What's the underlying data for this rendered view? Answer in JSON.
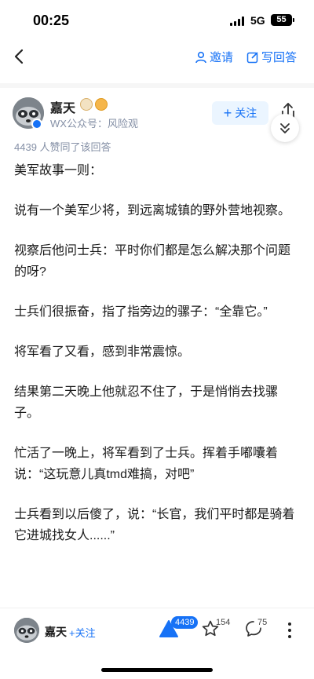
{
  "status_bar": {
    "time": "00:25",
    "network": "5G",
    "battery": "55"
  },
  "nav": {
    "invite_label": "邀请",
    "write_answer_label": "写回答"
  },
  "author": {
    "name": "嘉天",
    "description": "WX公众号：风险观",
    "follow_label": "关注"
  },
  "likes_line": "4439 人赞同了该回答",
  "content": {
    "paragraphs": [
      "美军故事一则：",
      "说有一个美军少将，到远离城镇的野外营地视察。",
      "视察后他问士兵：平时你们都是怎么解决那个问题的呀?",
      "士兵们很振奋，指了指旁边的骡子：“全靠它。”",
      "将军看了又看，感到非常震惊。",
      "结果第二天晚上他就忍不住了，于是悄悄去找骡子。",
      "忙活了一晚上，将军看到了士兵。挥着手嘟囔着说：“这玩意儿真tmd难搞，对吧”",
      "士兵看到以后傻了，说：“长官，我们平时都是骑着它进城找女人......”"
    ]
  },
  "bottom_bar": {
    "author_name": "嘉天",
    "follow_label": "+关注",
    "upvote_count": "4439",
    "favorite_count": "154",
    "comment_count": "75"
  },
  "colors": {
    "accent": "#1772f6",
    "muted": "#8590a6"
  }
}
